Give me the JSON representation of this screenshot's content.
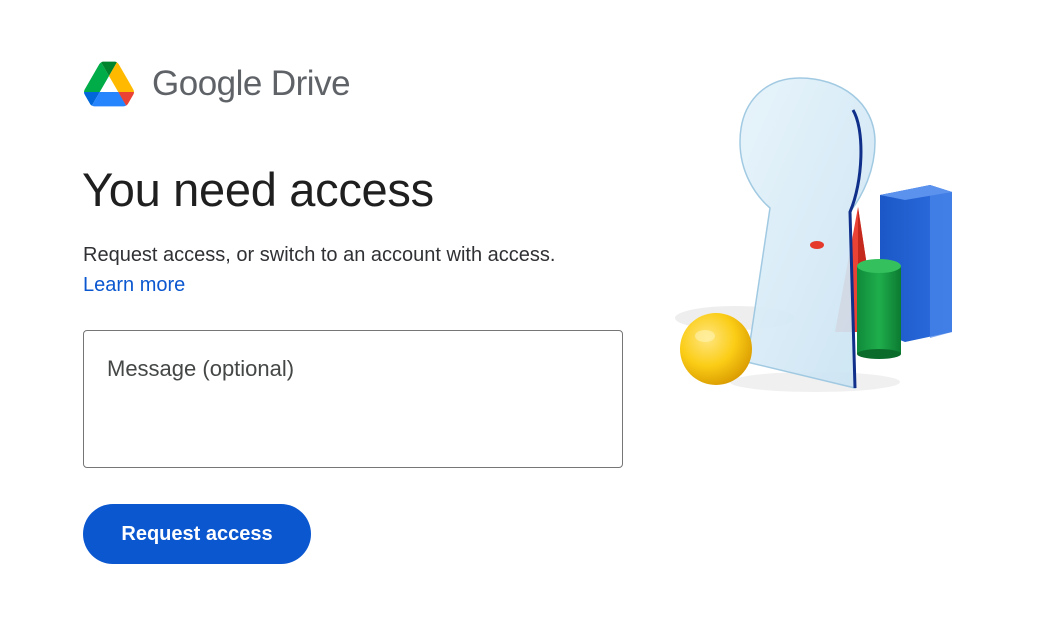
{
  "brand": {
    "name": "Google",
    "product": "Drive",
    "logo_icon": "google-drive-logo-icon"
  },
  "heading": "You need access",
  "description": "Request access, or switch to an account with access.",
  "learn_more_label": "Learn more",
  "message": {
    "placeholder": "Message (optional)",
    "value": ""
  },
  "request_button_label": "Request access",
  "illustration": {
    "icon": "keyhole-shapes-illustration"
  },
  "colors": {
    "primary": "#0b57d0",
    "drive_green": "#0066da",
    "drive_yellow": "#ffba00",
    "drive_red": "#ea4335"
  }
}
